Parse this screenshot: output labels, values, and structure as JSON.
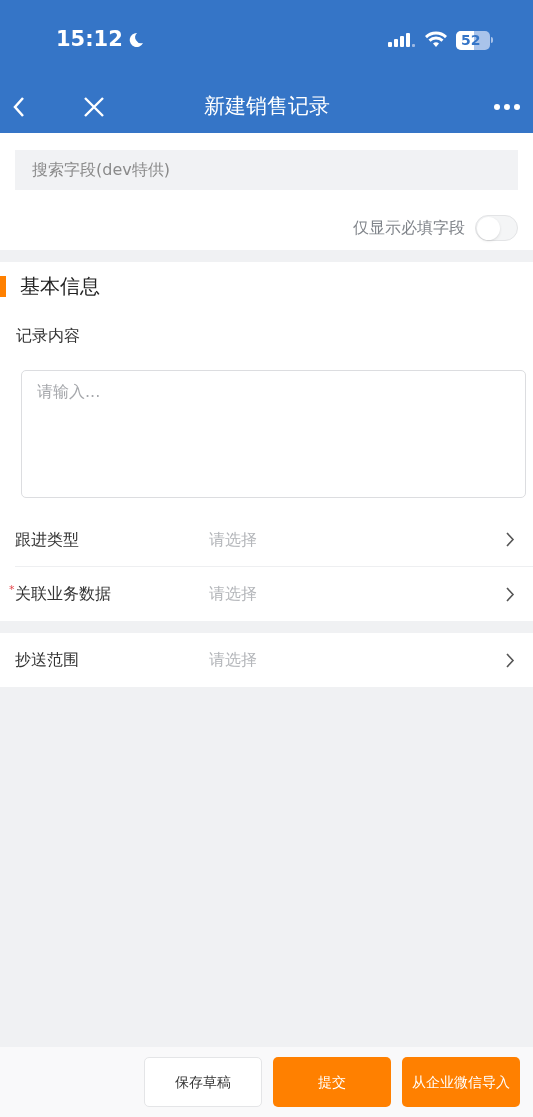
{
  "status_bar": {
    "time": "15:12",
    "battery": "52"
  },
  "nav": {
    "title": "新建销售记录"
  },
  "search": {
    "placeholder": "搜索字段(dev特供)"
  },
  "required_only": {
    "label": "仅显示必填字段",
    "on": false
  },
  "section": {
    "title": "基本信息"
  },
  "record_content": {
    "label": "记录内容",
    "placeholder": "请输入..."
  },
  "groups": [
    [
      {
        "label": "跟进类型",
        "placeholder": "请选择"
      },
      {
        "required_mark": "*",
        "label": "关联业务数据",
        "placeholder": "请选择"
      }
    ],
    [
      {
        "label": "抄送范围",
        "placeholder": "请选择"
      }
    ]
  ],
  "buttons": [
    {
      "label": "保存草稿",
      "kind": "secondary"
    },
    {
      "label": "提交",
      "kind": "primary"
    },
    {
      "label": "从企业微信导入",
      "kind": "primary"
    }
  ]
}
